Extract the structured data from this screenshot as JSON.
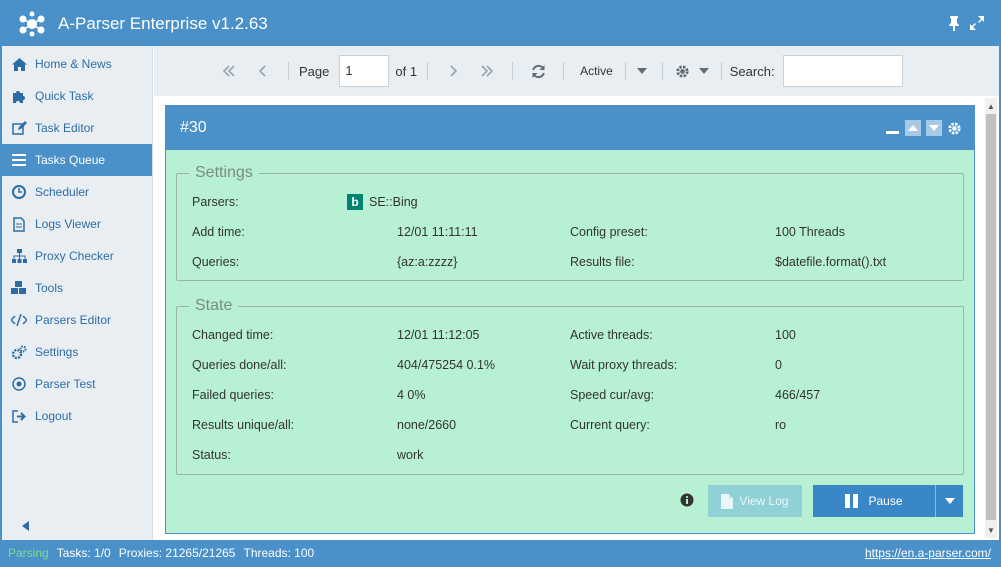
{
  "app": {
    "title": "A-Parser Enterprise v1.2.63"
  },
  "sidebar": {
    "items": [
      {
        "label": "Home & News",
        "icon": "home-icon"
      },
      {
        "label": "Quick Task",
        "icon": "puzzle-icon"
      },
      {
        "label": "Task Editor",
        "icon": "edit-icon"
      },
      {
        "label": "Tasks Queue",
        "icon": "list-icon",
        "active": true
      },
      {
        "label": "Scheduler",
        "icon": "clock-icon"
      },
      {
        "label": "Logs Viewer",
        "icon": "file-icon"
      },
      {
        "label": "Proxy Checker",
        "icon": "network-icon"
      },
      {
        "label": "Tools",
        "icon": "cubes-icon"
      },
      {
        "label": "Parsers Editor",
        "icon": "code-icon"
      },
      {
        "label": "Settings",
        "icon": "gears-icon"
      },
      {
        "label": "Parser Test",
        "icon": "target-icon"
      },
      {
        "label": "Logout",
        "icon": "logout-icon"
      }
    ]
  },
  "toolbar": {
    "page_label": "Page",
    "page_value": "1",
    "of_label": "of 1",
    "filter_label": "Active",
    "search_label": "Search:",
    "search_value": ""
  },
  "task": {
    "id": "#30",
    "settings": {
      "legend": "Settings",
      "parsers_label": "Parsers:",
      "parsers_value": "SE::Bing",
      "add_time_label": "Add time:",
      "add_time_value": "12/01 11:11:11",
      "config_preset_label": "Config preset:",
      "config_preset_value": "100 Threads",
      "queries_label": "Queries:",
      "queries_value": "{az:a:zzzz}",
      "results_file_label": "Results file:",
      "results_file_value": "$datefile.format().txt"
    },
    "state": {
      "legend": "State",
      "changed_time_label": "Changed time:",
      "changed_time_value": "12/01 11:12:05",
      "active_threads_label": "Active threads:",
      "active_threads_value": "100",
      "queries_done_label": "Queries done/all:",
      "queries_done_value": "404/475254 0.1%",
      "wait_proxy_label": "Wait proxy threads:",
      "wait_proxy_value": "0",
      "failed_label": "Failed queries:",
      "failed_value": "4 0%",
      "speed_label": "Speed cur/avg:",
      "speed_value": "466/457",
      "results_label": "Results unique/all:",
      "results_value": "none/2660",
      "current_query_label": "Current query:",
      "current_query_value": "ro",
      "status_label": "Status:",
      "status_value": "work"
    },
    "buttons": {
      "view_log": "View Log",
      "pause": "Pause"
    }
  },
  "statusbar": {
    "state": "Parsing",
    "tasks": "Tasks: 1/0",
    "proxies": "Proxies: 21265/21265",
    "threads": "Threads: 100",
    "link": "https://en.a-parser.com/"
  },
  "colors": {
    "accent": "#4a90c9",
    "panel_bg": "#b7f0d2",
    "parsing": "#7ddf8d",
    "bing": "#008373"
  }
}
